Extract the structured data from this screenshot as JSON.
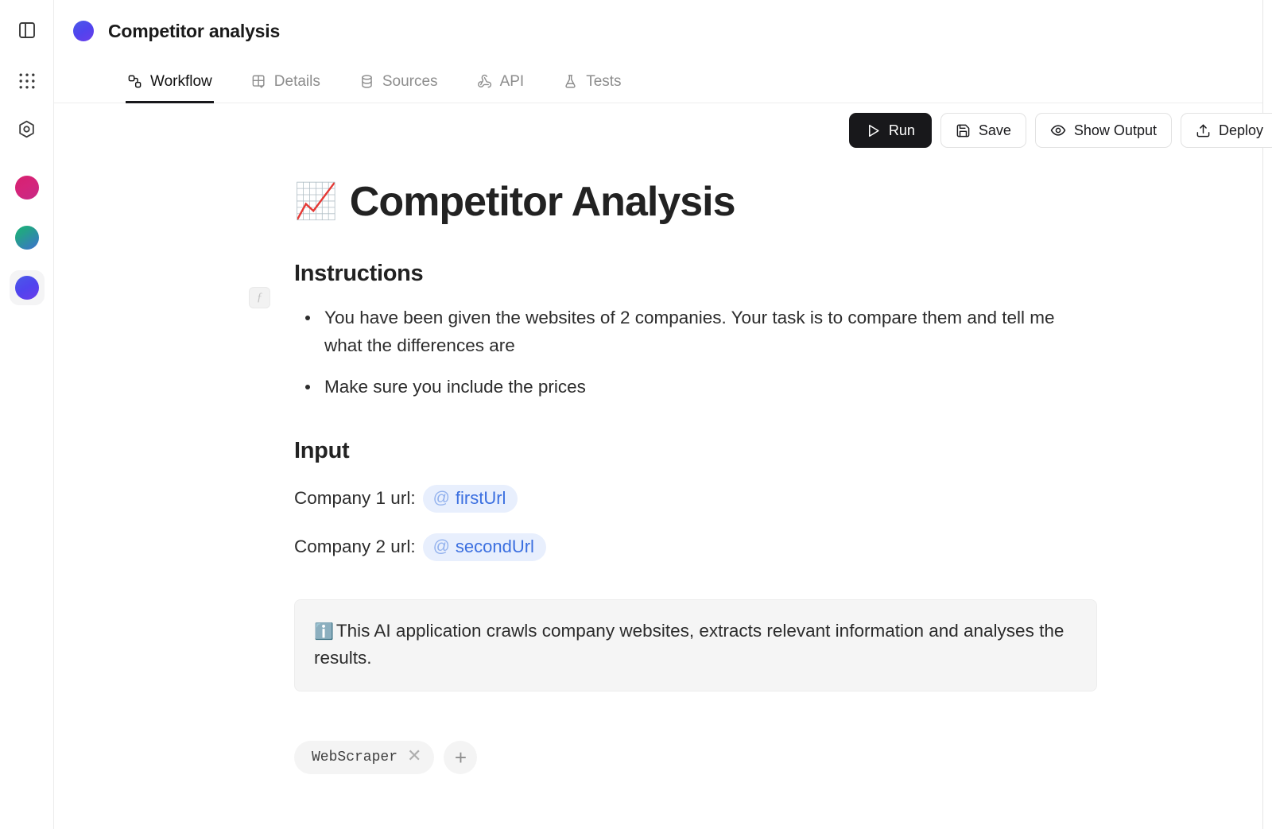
{
  "rail": {
    "toggle_sidebar_icon": "panel-left-icon",
    "apps_grid_icon": "grid-apps-icon",
    "hexagon_icon": "hexagon-settings-icon",
    "workspaces": [
      {
        "name": "workspace-pink",
        "color": "#d5247a",
        "selected": false
      },
      {
        "name": "workspace-green",
        "color": "#23a387",
        "selected": false
      },
      {
        "name": "workspace-blue",
        "color": "#5044ee",
        "selected": true
      }
    ]
  },
  "header": {
    "app_dot_color": "#5044ee",
    "title": "Competitor analysis"
  },
  "tabs": [
    {
      "label": "Workflow",
      "icon": "workflow-nodes-icon",
      "active": true
    },
    {
      "label": "Details",
      "icon": "layout-grid-check-icon",
      "active": false
    },
    {
      "label": "Sources",
      "icon": "database-icon",
      "active": false
    },
    {
      "label": "API",
      "icon": "webhook-icon",
      "active": false
    },
    {
      "label": "Tests",
      "icon": "flask-icon",
      "active": false
    }
  ],
  "toolbar": {
    "run_label": "Run",
    "save_label": "Save",
    "show_output_label": "Show Output",
    "deploy_label": "Deploy"
  },
  "document": {
    "fx_glyph": "ƒ",
    "title_emoji": "📈",
    "title": "Competitor Analysis",
    "instructions_heading": "Instructions",
    "instructions": [
      "You have been given the websites of 2 companies. Your task is to compare them and tell me what the differences are",
      "Make sure you include the prices"
    ],
    "input_heading": "Input",
    "input_rows": [
      {
        "label": "Company 1 url:",
        "at": "@",
        "variable": "firstUrl"
      },
      {
        "label": "Company 2 url:",
        "at": "@",
        "variable": "secondUrl"
      }
    ],
    "callout_emoji": "ℹ️",
    "callout_text": "This AI application crawls company websites, extracts relevant information and analyses the results.",
    "tags": [
      {
        "label": "WebScraper",
        "remove_glyph": "✕"
      }
    ],
    "add_tag_glyph": "+"
  }
}
